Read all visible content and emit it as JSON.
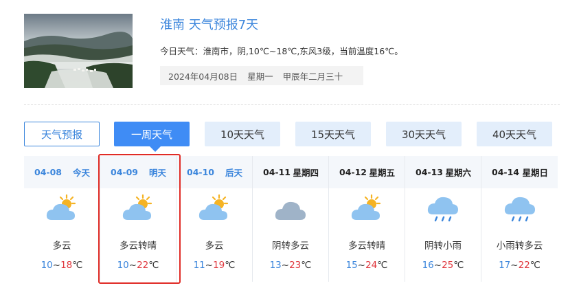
{
  "header": {
    "city_title": "淮南 天气预报7天",
    "today_summary": "今日天气：淮南市，阴,10℃~18℃,东风3级，当前温度16℃。",
    "date": "2024年04月08日",
    "weekday": "星期一",
    "lunar": "甲辰年二月三十"
  },
  "tabs": [
    {
      "label": "天气预报",
      "state": "outline"
    },
    {
      "label": "一周天气",
      "state": "active"
    },
    {
      "label": "10天天气",
      "state": "plain"
    },
    {
      "label": "15天天气",
      "state": "plain"
    },
    {
      "label": "30天天气",
      "state": "plain"
    },
    {
      "label": "40天天气",
      "state": "plain"
    }
  ],
  "days": [
    {
      "date": "04-08",
      "dow": "今天",
      "weather": "多云",
      "low": "10",
      "high": "18",
      "unit": "℃",
      "icon": "partly-cloudy-icon",
      "highlight": true
    },
    {
      "date": "04-09",
      "dow": "明天",
      "weather": "多云转晴",
      "low": "10",
      "high": "22",
      "unit": "℃",
      "icon": "partly-cloudy-icon",
      "highlight": true
    },
    {
      "date": "04-10",
      "dow": "后天",
      "weather": "多云",
      "low": "11",
      "high": "19",
      "unit": "℃",
      "icon": "partly-cloudy-icon",
      "highlight": true
    },
    {
      "date": "04-11",
      "dow": "星期四",
      "weather": "阴转多云",
      "low": "13",
      "high": "23",
      "unit": "℃",
      "icon": "overcast-icon",
      "highlight": false
    },
    {
      "date": "04-12",
      "dow": "星期五",
      "weather": "多云转晴",
      "low": "15",
      "high": "24",
      "unit": "℃",
      "icon": "partly-cloudy-icon",
      "highlight": false
    },
    {
      "date": "04-13",
      "dow": "星期六",
      "weather": "阴转小雨",
      "low": "16",
      "high": "25",
      "unit": "℃",
      "icon": "light-rain-icon",
      "highlight": false
    },
    {
      "date": "04-14",
      "dow": "星期日",
      "weather": "小雨转多云",
      "low": "17",
      "high": "22",
      "unit": "℃",
      "icon": "light-rain-icon",
      "highlight": false
    }
  ],
  "colors": {
    "accent": "#3c86dc",
    "active_tab": "#3f8cf5",
    "tab_bg": "#e3eefb",
    "temp_low": "#3c86dc",
    "temp_high": "#e0383e",
    "annotation_box": "#e02b25"
  }
}
